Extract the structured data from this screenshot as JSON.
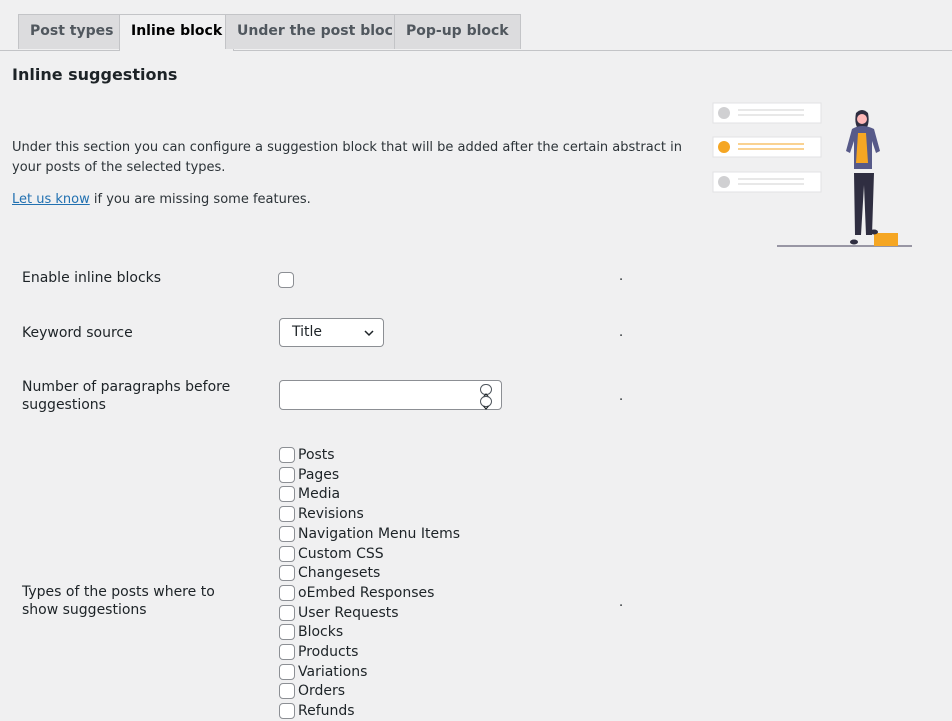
{
  "tabs": [
    {
      "label": "Post types"
    },
    {
      "label": "Inline block"
    },
    {
      "label": "Under the post block"
    },
    {
      "label": "Pop-up block"
    }
  ],
  "active_tab": "Inline block",
  "section": {
    "title": "Inline suggestions",
    "description": "Under this section you can configure a suggestion block that will be added after the certain abstract in your posts of the selected types.",
    "feedback_link": "Let us know",
    "feedback_rest": " if you are missing some features."
  },
  "fields": {
    "enable": {
      "label": "Enable inline blocks",
      "checked": false,
      "suffix": "."
    },
    "keyword_source": {
      "label": "Keyword source",
      "value": "Title",
      "suffix": "."
    },
    "paragraphs": {
      "label": "Number of paragraphs before suggestions",
      "value": "",
      "suffix": "."
    },
    "post_types": {
      "label": "Types of the posts where to show suggestions",
      "suffix": ".",
      "options": [
        "Posts",
        "Pages",
        "Media",
        "Revisions",
        "Navigation Menu Items",
        "Custom CSS",
        "Changesets",
        "oEmbed Responses",
        "User Requests",
        "Blocks",
        "Products",
        "Variations",
        "Orders",
        "Refunds"
      ]
    }
  },
  "colors": {
    "accent": "#f5a623",
    "link": "#2271b1",
    "figure_dark": "#2f2e41",
    "figure_jacket": "#575a89"
  }
}
